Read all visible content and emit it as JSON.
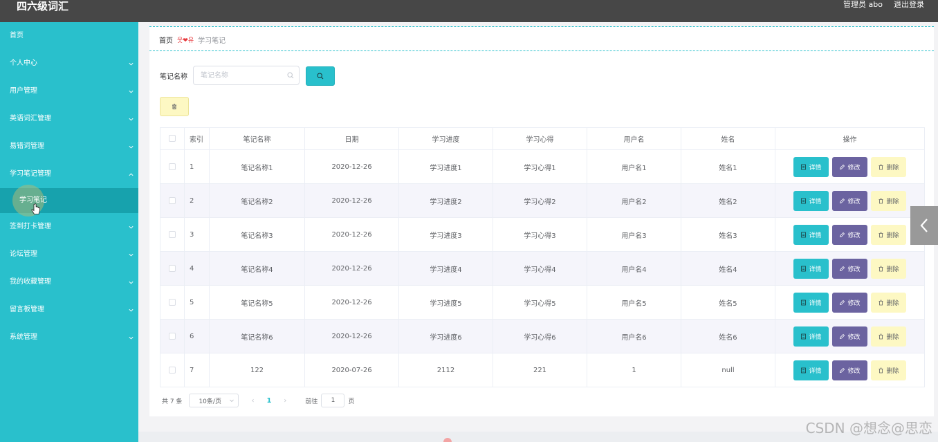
{
  "app": {
    "title": "四六级词汇"
  },
  "header": {
    "user_label": "管理员 abo",
    "logout_label": "退出登录"
  },
  "sidebar": {
    "items": [
      {
        "label": "首页",
        "chevron": ""
      },
      {
        "label": "个人中心",
        "chevron": "down"
      },
      {
        "label": "用户管理",
        "chevron": "down"
      },
      {
        "label": "英语词汇管理",
        "chevron": "down"
      },
      {
        "label": "易错词管理",
        "chevron": "down"
      },
      {
        "label": "学习笔记管理",
        "chevron": "up"
      },
      {
        "label": "签到打卡管理",
        "chevron": "down"
      },
      {
        "label": "论坛管理",
        "chevron": "down"
      },
      {
        "label": "我的收藏管理",
        "chevron": "down"
      },
      {
        "label": "留言板管理",
        "chevron": "down"
      },
      {
        "label": "系统管理",
        "chevron": "down"
      }
    ],
    "active_sub": "学习笔记"
  },
  "breadcrumb": {
    "home": "首页",
    "separator": "웃❤유",
    "current": "学习笔记"
  },
  "search": {
    "label": "笔记名称",
    "placeholder": "笔记名称",
    "value": ""
  },
  "table": {
    "headers": [
      "",
      "索引",
      "笔记名称",
      "日期",
      "学习进度",
      "学习心得",
      "用户名",
      "姓名",
      "操作"
    ],
    "rows": [
      [
        "1",
        "笔记名称1",
        "2020-12-26",
        "学习进度1",
        "学习心得1",
        "用户名1",
        "姓名1"
      ],
      [
        "2",
        "笔记名称2",
        "2020-12-26",
        "学习进度2",
        "学习心得2",
        "用户名2",
        "姓名2"
      ],
      [
        "3",
        "笔记名称3",
        "2020-12-26",
        "学习进度3",
        "学习心得3",
        "用户名3",
        "姓名3"
      ],
      [
        "4",
        "笔记名称4",
        "2020-12-26",
        "学习进度4",
        "学习心得4",
        "用户名4",
        "姓名4"
      ],
      [
        "5",
        "笔记名称5",
        "2020-12-26",
        "学习进度5",
        "学习心得5",
        "用户名5",
        "姓名5"
      ],
      [
        "6",
        "笔记名称6",
        "2020-12-26",
        "学习进度6",
        "学习心得6",
        "用户名6",
        "姓名6"
      ],
      [
        "7",
        "122",
        "2020-07-26",
        "2112",
        "221",
        "1",
        "null"
      ]
    ],
    "actions": {
      "detail": "详情",
      "edit": "修改",
      "delete": "删除"
    }
  },
  "pagination": {
    "total": "共 7 条",
    "page_size": "10条/页",
    "current_page": "1",
    "goto_label": "前往",
    "goto_value": "1",
    "page_unit": "页"
  },
  "watermark": "CSDN @想念@思恋",
  "colors": {
    "accent": "#29c0cc",
    "edit": "#6b63a0",
    "delete_bg": "#fdf8c3",
    "topbar": "#474747"
  }
}
